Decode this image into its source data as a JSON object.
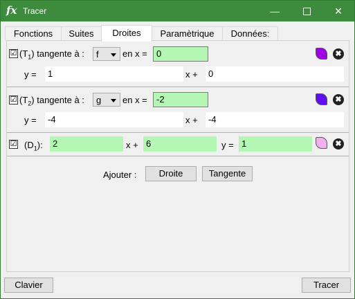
{
  "window": {
    "app_icon": "fx",
    "title": "Tracer",
    "controls": {
      "minimize": "—",
      "close": "✕"
    }
  },
  "tabs": [
    {
      "label": "Fonctions",
      "active": false
    },
    {
      "label": "Suites",
      "active": false
    },
    {
      "label": "Droites",
      "active": true
    },
    {
      "label": "Paramètrique",
      "active": false
    },
    {
      "label": "Données:",
      "active": false
    }
  ],
  "rows": {
    "t1": {
      "checked": true,
      "check_mark": "☑",
      "label_prefix": "(T",
      "subscript": "1",
      "label_suffix": ") tangente à :",
      "function": "f",
      "en_x_label": "en x =",
      "x_value": "0",
      "color": "#a000e8",
      "y_label": "y =",
      "slope": "1",
      "xplus_label": "x +",
      "intercept": "0"
    },
    "t2": {
      "checked": true,
      "check_mark": "☑",
      "label_prefix": "(T",
      "subscript": "2",
      "label_suffix": ") tangente à :",
      "function": "g",
      "en_x_label": "en x =",
      "x_value": "-2",
      "color": "#6010f0",
      "y_label": "y =",
      "slope": "-4",
      "xplus_label": "x +",
      "intercept": "-4"
    },
    "d1": {
      "checked": true,
      "check_mark": "☑",
      "label_prefix": "(D",
      "subscript": "1",
      "label_suffix": "):",
      "a": "2",
      "xplus_label": "x +",
      "b": "6",
      "y_label": "y =",
      "c": "1",
      "color": "#f4b0f0"
    }
  },
  "add": {
    "label": "Ajouter :",
    "droite_button": "Droite",
    "tangente_button": "Tangente"
  },
  "footer": {
    "clavier_button": "Clavier",
    "tracer_button": "Tracer"
  },
  "icons": {
    "delete": "✖"
  }
}
